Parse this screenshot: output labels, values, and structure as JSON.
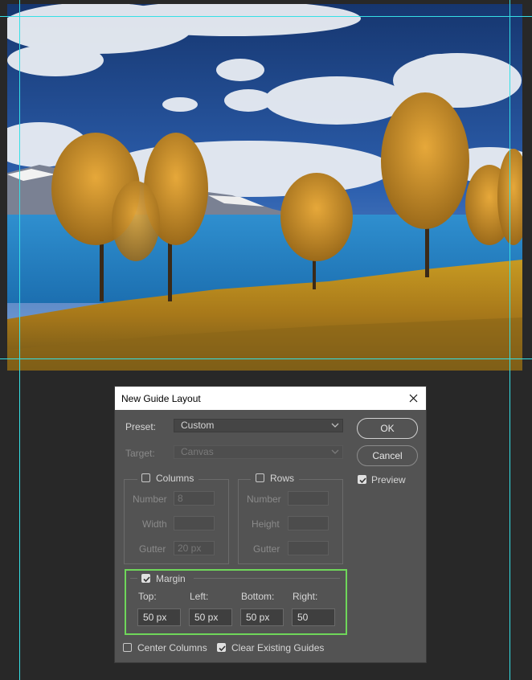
{
  "dialog": {
    "title": "New Guide Layout",
    "preset": {
      "label": "Preset:",
      "value": "Custom"
    },
    "target": {
      "label": "Target:",
      "value": "Canvas"
    },
    "columns": {
      "label": "Columns",
      "checked": false,
      "number_label": "Number",
      "number_value": "8",
      "width_label": "Width",
      "width_value": "",
      "gutter_label": "Gutter",
      "gutter_value": "20 px"
    },
    "rows": {
      "label": "Rows",
      "checked": false,
      "number_label": "Number",
      "number_value": "",
      "height_label": "Height",
      "height_value": "",
      "gutter_label": "Gutter",
      "gutter_value": ""
    },
    "margin": {
      "label": "Margin",
      "checked": true,
      "top_label": "Top:",
      "top_value": "50 px",
      "left_label": "Left:",
      "left_value": "50 px",
      "bottom_label": "Bottom:",
      "bottom_value": "50 px",
      "right_label": "Right:",
      "right_value": "50"
    },
    "center_columns": {
      "label": "Center Columns",
      "checked": false
    },
    "clear_guides": {
      "label": "Clear Existing Guides",
      "checked": true
    },
    "buttons": {
      "ok": "OK",
      "cancel": "Cancel"
    },
    "preview": {
      "label": "Preview",
      "checked": true
    }
  },
  "colors": {
    "guide": "#35e0e6",
    "highlight": "#6fd65a",
    "dialog_bg": "#535353",
    "workspace_bg": "#282828"
  }
}
